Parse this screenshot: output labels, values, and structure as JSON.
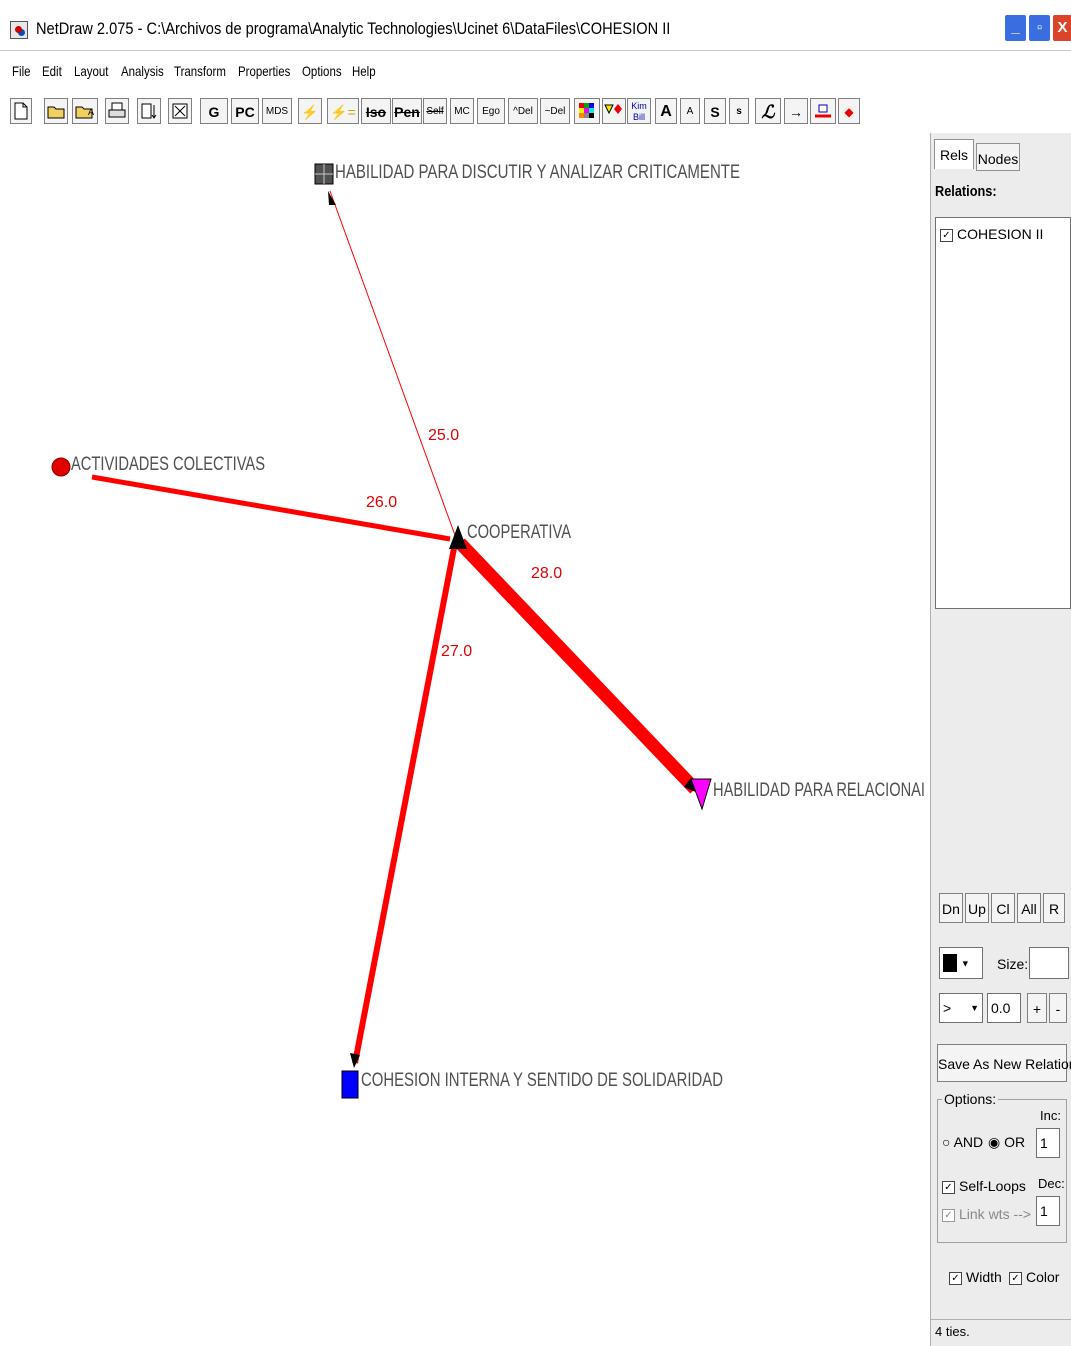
{
  "window": {
    "title": "NetDraw 2.075 - C:\\Archivos de programa\\Analytic Technologies\\Ucinet 6\\DataFiles\\COHESION II",
    "min_symbol": "_",
    "max_symbol": "▫",
    "close_symbol": "X"
  },
  "menu": [
    "File",
    "Edit",
    "Layout",
    "Analysis",
    "Transform",
    "Properties",
    "Options",
    "Help"
  ],
  "toolbar": {
    "new_icon": "new-file-icon",
    "open_icon": "open-folder-icon",
    "g": "G",
    "pc": "PC",
    "mds": "MDS",
    "iso": "Iso",
    "pen": "Pen",
    "self": "Self",
    "mc": "MC",
    "ego": "Ego",
    "del1": "^Del",
    "del2": "~Del",
    "kim": "Kim Bill",
    "a_big": "A",
    "a_small": "A",
    "s_big": "S",
    "s_small": "s"
  },
  "network": {
    "nodes": [
      {
        "id": "habilidad-discutir",
        "label": "HABILIDAD PARA DISCUTIR Y ANALIZAR CRITICAMENTE",
        "shape": "grid-square",
        "color": "#505050"
      },
      {
        "id": "actividades-colectivas",
        "label": "ACTIVIDADES COLECTIVAS",
        "shape": "circle",
        "color": "#e00000"
      },
      {
        "id": "cooperativa",
        "label": "COOPERATIVA",
        "shape": "triangle-up",
        "color": "#000000"
      },
      {
        "id": "habilidad-relacionar",
        "label": "HABILIDAD PARA RELACIONAI",
        "shape": "triangle-down",
        "color": "#ff00ff"
      },
      {
        "id": "cohesion-interna",
        "label": "COHESION INTERNA Y SENTIDO DE SOLIDARIDAD",
        "shape": "square",
        "color": "#0000ff"
      }
    ],
    "edges": [
      {
        "from": "cooperativa",
        "to": "habilidad-discutir",
        "weight": "25.0"
      },
      {
        "from": "actividades-colectivas",
        "to": "cooperativa",
        "weight": "26.0"
      },
      {
        "from": "cooperativa",
        "to": "cohesion-interna",
        "weight": "27.0"
      },
      {
        "from": "cooperativa",
        "to": "habilidad-relacionar",
        "weight": "28.0"
      }
    ],
    "edge_color": "#ff0000"
  },
  "panel": {
    "tabs": {
      "rels": "Rels",
      "nodes": "Nodes"
    },
    "relations_label": "Relations:",
    "relations": [
      {
        "name": "COHESION II",
        "checked": true
      }
    ],
    "nav_buttons": {
      "dn": "Dn",
      "up": "Up",
      "cl": "Cl",
      "all": "All",
      "r": "R"
    },
    "size_label": "Size:",
    "size_value": "",
    "arrow_select": ">",
    "threshold_value": "0.0",
    "plus": "+",
    "minus": "-",
    "save_relation": "Save As New Relation",
    "options_label": "Options:",
    "inc_label": "Inc:",
    "inc_value": "1",
    "and_label": "AND",
    "or_label": "OR",
    "selected_logic": "OR",
    "self_loops_label": "Self-Loops",
    "self_loops_checked": true,
    "dec_label": "Dec:",
    "dec_value": "1",
    "link_wts_label": "Link wts -->",
    "link_wts_checked": true,
    "width_label": "Width",
    "width_checked": true,
    "color_label": "Color",
    "color_checked": true,
    "status": "4 ties."
  }
}
